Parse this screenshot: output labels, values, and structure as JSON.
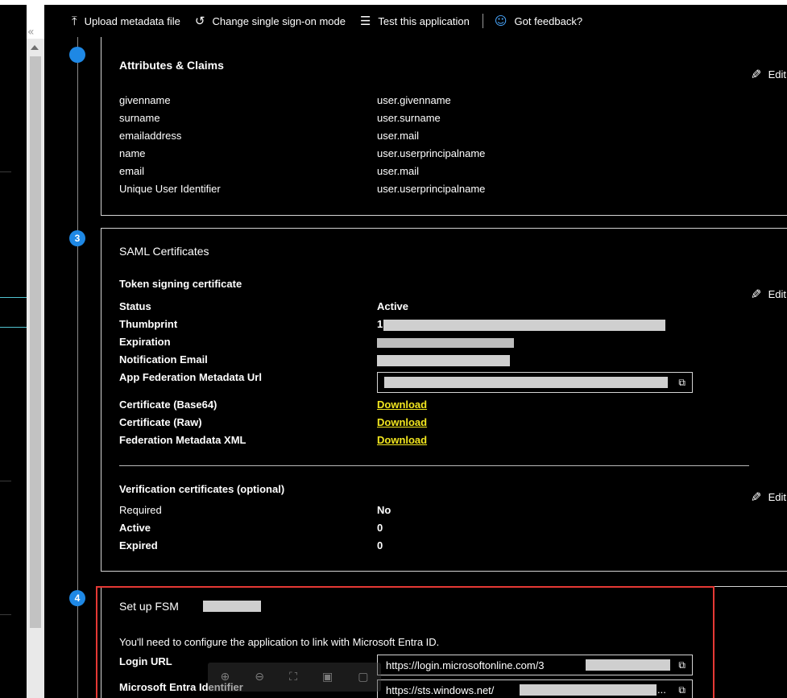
{
  "toolbar": {
    "upload_label": "Upload metadata file",
    "upload_icon": "upload-icon",
    "change_label": "Change single sign-on mode",
    "change_icon": "undo-icon",
    "test_label": "Test this application",
    "test_icon": "list-icon",
    "feedback_label": "Got feedback?",
    "feedback_icon": "feedback-person-icon"
  },
  "left_pane": {
    "collapse_glyph": "«"
  },
  "attributes": {
    "title": "Attributes & Claims",
    "edit_label": "Edit",
    "rows": [
      {
        "name": "givenname",
        "value": "user.givenname"
      },
      {
        "name": "surname",
        "value": "user.surname"
      },
      {
        "name": "emailaddress",
        "value": "user.mail"
      },
      {
        "name": "name",
        "value": "user.userprincipalname"
      },
      {
        "name": "email",
        "value": "user.mail"
      },
      {
        "name": "Unique User Identifier",
        "value": "user.userprincipalname"
      }
    ]
  },
  "saml": {
    "step": "3",
    "title": "SAML Certificates",
    "token_heading": "Token signing certificate",
    "edit_label": "Edit",
    "status_label": "Status",
    "status_value": "Active",
    "thumbprint_label": "Thumbprint",
    "thumbprint_value": "1",
    "expiration_label": "Expiration",
    "notification_label": "Notification Email",
    "metadata_url_label": "App Federation Metadata Url",
    "cert_base64_label": "Certificate (Base64)",
    "cert_raw_label": "Certificate (Raw)",
    "fed_xml_label": "Federation Metadata XML",
    "download_label": "Download",
    "verification_heading": "Verification certificates (optional)",
    "verification_edit_label": "Edit",
    "required_label": "Required",
    "required_value": "No",
    "active_label": "Active",
    "active_value": "0",
    "expired_label": "Expired",
    "expired_value": "0"
  },
  "setup": {
    "step": "4",
    "step_top": "4",
    "title": "Set up FSM",
    "description": "You'll need to configure the application to link with Microsoft Entra ID.",
    "login_url_label": "Login URL",
    "login_url_value": "https://login.microsoftonline.com/3",
    "entra_id_label": "Microsoft Entra Identifier",
    "entra_id_value": "https://sts.windows.net/",
    "entra_id_suffix": "..."
  },
  "colors": {
    "accent": "#1e88e5",
    "link": "#f2e61f",
    "highlight": "#e53935"
  }
}
